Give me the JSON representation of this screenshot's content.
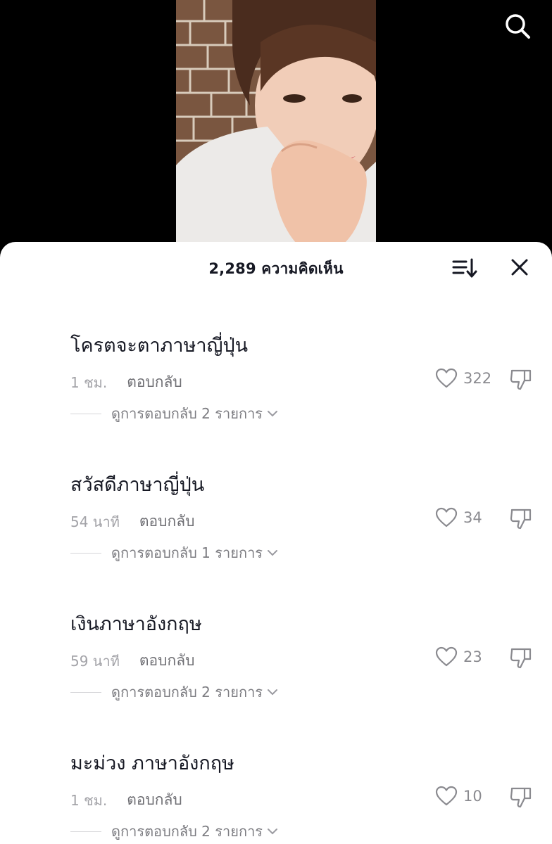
{
  "header": {
    "comment_count_title": "2,289 ความคิดเห็น"
  },
  "icons": {
    "search": "search-icon",
    "sort": "sort-icon",
    "close": "close-icon",
    "like": "heart-icon",
    "dislike": "thumbs-down-icon"
  },
  "colors": {
    "sheet_background": "#ffffff",
    "backdrop": "#000000",
    "primary_text": "#161823",
    "secondary_text": "#9a9aa0"
  },
  "comments": [
    {
      "text": "โครตจะตาภาษาญี่ปุ่น",
      "time": "1 ชม.",
      "reply_label": "ตอบกลับ",
      "likes": "322",
      "view_replies": "ดูการตอบกลับ 2 รายการ"
    },
    {
      "text": "สวัสดีภาษาญี่ปุ่น",
      "time": "54 นาที",
      "reply_label": "ตอบกลับ",
      "likes": "34",
      "view_replies": "ดูการตอบกลับ 1 รายการ"
    },
    {
      "text": "เงินภาษาอังกฤษ",
      "time": "59 นาที",
      "reply_label": "ตอบกลับ",
      "likes": "23",
      "view_replies": "ดูการตอบกลับ 2 รายการ"
    },
    {
      "text": "มะม่วง ภาษาอังกฤษ",
      "time": "1 ชม.",
      "reply_label": "ตอบกลับ",
      "likes": "10",
      "view_replies": "ดูการตอบกลับ 2 รายการ"
    }
  ]
}
